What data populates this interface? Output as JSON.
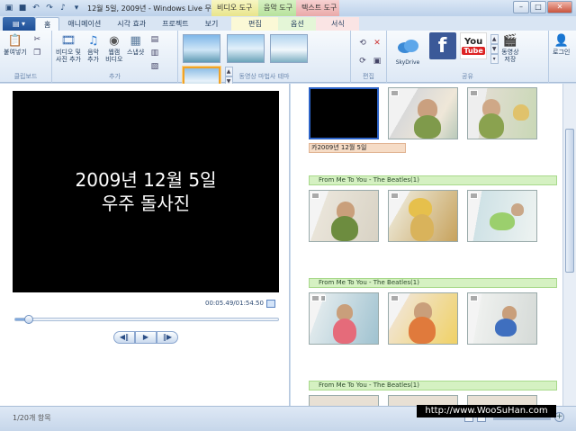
{
  "window": {
    "title": "12월 5일, 2009년 - Windows Live 무비 ...",
    "context_video": "비디오 도구",
    "context_music": "음악 도구",
    "context_text": "텍스트 도구"
  },
  "tabs": {
    "home": "홈",
    "animations": "애니메이션",
    "visual_effects": "시각 효과",
    "project": "프로젝트",
    "view": "보기",
    "edit": "편집",
    "options": "옵션",
    "format": "서식"
  },
  "ribbon": {
    "clipboard": {
      "group": "클립보드",
      "paste": "붙여넣기"
    },
    "add": {
      "group": "추가",
      "add_video": "비디오 및\n사진 추가",
      "add_music": "음악\n추가",
      "webcam": "웹캠\n비디오",
      "snapshot": "스냅샷"
    },
    "themes": {
      "group": "동영상 마법사 테마"
    },
    "editing": {
      "group": "편집"
    },
    "sharing": {
      "group": "공유",
      "skydrive": "SkyDrive",
      "save_movie": "동영상\n저장",
      "login": "로그인",
      "facebook": "f",
      "youtube_you": "You",
      "youtube_tube": "Tube"
    }
  },
  "preview": {
    "caption_line1": "2009년 12월 5일",
    "caption_line2": "우주 돌사진",
    "timecode": "00:05.49/01:54.50",
    "progress": 0.05
  },
  "storyboard": {
    "caption": "카2009년 12월 5일",
    "music_label": "From Me To You - The Beatles(1)"
  },
  "status": {
    "items": "1/20개 항목"
  },
  "watermark": "http://www.WooSuHan.com",
  "colors": {
    "accent": "#1e4f96",
    "music_bar": "#d5f1c2",
    "caption_bar": "#f6dcc6"
  }
}
